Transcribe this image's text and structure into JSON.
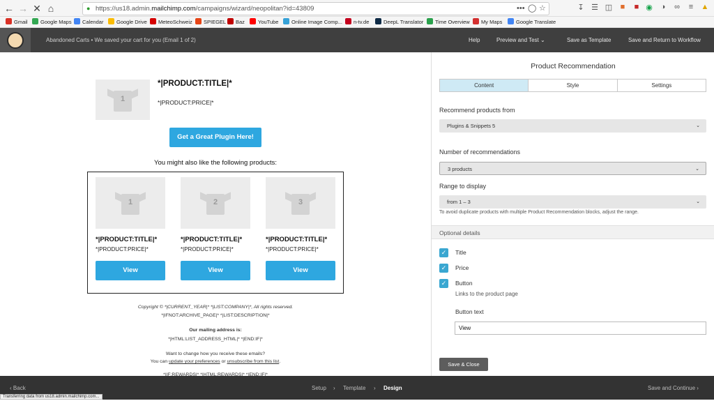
{
  "browser": {
    "url_prefix": "https://us18.admin.",
    "url_domain": "mailchimp.com",
    "url_path": "/campaigns/wizard/neopolitan?id=43809",
    "url_more": "•••"
  },
  "bookmarks": [
    {
      "label": "Gmail",
      "color": "#d93025"
    },
    {
      "label": "Google Maps",
      "color": "#34a853"
    },
    {
      "label": "Calendar",
      "color": "#4285f4"
    },
    {
      "label": "Google Drive",
      "color": "#fbbc04"
    },
    {
      "label": "MeteoSchweiz",
      "color": "#d50000"
    },
    {
      "label": "SPIEGEL",
      "color": "#e64415"
    },
    {
      "label": "Baz",
      "color": "#c00000"
    },
    {
      "label": "YouTube",
      "color": "#ff0000"
    },
    {
      "label": "Online Image Comp...",
      "color": "#36a2d8"
    },
    {
      "label": "n-tv.de",
      "color": "#c4001d"
    },
    {
      "label": "DeepL Translator",
      "color": "#0f2b46"
    },
    {
      "label": "Time Overview",
      "color": "#2aa14c"
    },
    {
      "label": "My Maps",
      "color": "#d32f2f"
    },
    {
      "label": "Google Translate",
      "color": "#4285f4"
    }
  ],
  "appbar": {
    "crumb": "Abandoned Carts • We saved your cart for you (Email 1 of 2)",
    "help": "Help",
    "preview": "Preview and Test",
    "save_template": "Save as Template",
    "save_return": "Save and Return to Workflow"
  },
  "email": {
    "main_product": {
      "title": "*|PRODUCT:TITLE|*",
      "price": "*|PRODUCT:PRICE|*",
      "image_number": "1"
    },
    "cta_button": "Get a Great Plugin Here!",
    "recommend_heading": "You might also like the following products:",
    "products": [
      {
        "number": "1",
        "title": "*|PRODUCT:TITLE|*",
        "price": "*|PRODUCT:PRICE|*",
        "button": "View"
      },
      {
        "number": "2",
        "title": "*|PRODUCT:TITLE|*",
        "price": "*|PRODUCT:PRICE|*",
        "button": "View"
      },
      {
        "number": "3",
        "title": "*|PRODUCT:TITLE|*",
        "price": "*|PRODUCT:PRICE|*",
        "button": "View"
      }
    ],
    "footer": {
      "copyright": "Copyright © *|CURRENT_YEAR|* *|LIST:COMPANY|*, All rights reserved.",
      "archive": "*|IFNOT:ARCHIVE_PAGE|* *|LIST:DESCRIPTION|*",
      "mailing_heading": "Our mailing address is:",
      "address": "*|HTML:LIST_ADDRESS_HTML|* *|END:IF|*",
      "change_text": "Want to change how you receive these emails?",
      "update_prefix": "You can ",
      "update_link": "update your preferences",
      "update_or": " or ",
      "unsubscribe_link": "unsubscribe from this list",
      "update_suffix": ".",
      "rewards": "*|IF:REWARDS|* *|HTML:REWARDS|* *|END:IF|*"
    }
  },
  "panel": {
    "title": "Product Recommendation",
    "tabs": [
      "Content",
      "Style",
      "Settings"
    ],
    "recommend_label": "Recommend products from",
    "recommend_value": "Plugins & Snippets 5",
    "number_label": "Number of recommendations",
    "number_value": "3 products",
    "range_label": "Range to display",
    "range_value": "from 1 – 3",
    "range_hint": "To avoid duplicate products with multiple Product Recommendation blocks, adjust the range.",
    "optional_heading": "Optional details",
    "options": [
      {
        "label": "Title",
        "checked": true
      },
      {
        "label": "Price",
        "checked": true
      },
      {
        "label": "Button",
        "checked": true
      }
    ],
    "button_hint": "Links to the product page",
    "button_text_label": "Button text",
    "button_text_value": "View",
    "save_close": "Save & Close"
  },
  "bottom": {
    "back": "Back",
    "steps": [
      "Setup",
      "Template",
      "Design"
    ],
    "active_step": "Design",
    "next": "Save and Continue"
  },
  "status": "Transferring data from us18.admin.mailchimp.com...",
  "colors": {
    "accent_blue": "#2ea7e0",
    "checkbox_blue": "#3aa7d1",
    "active_tab": "#cfeaf5",
    "appbar": "#3f3f3f"
  }
}
